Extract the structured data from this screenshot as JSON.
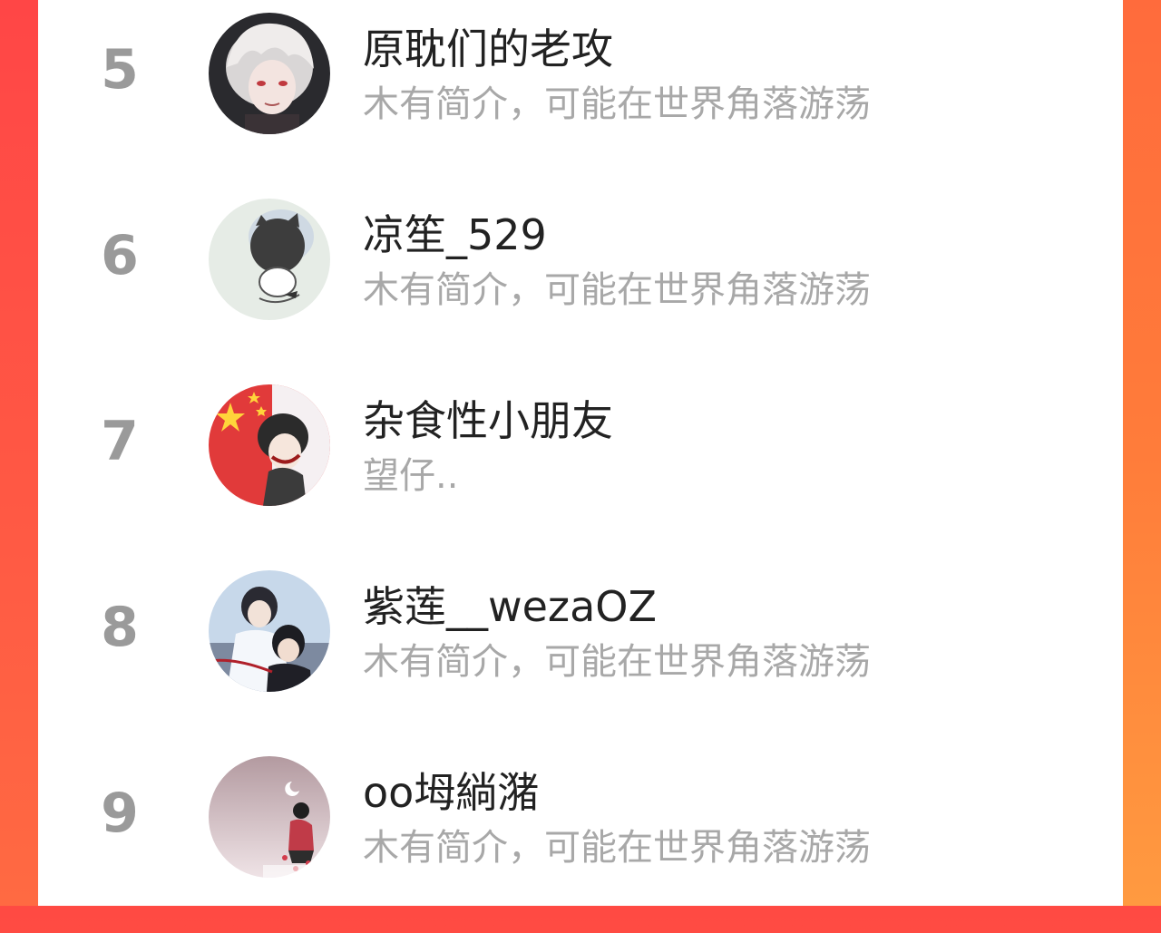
{
  "ranking": {
    "items": [
      {
        "rank": "5",
        "name": "原耽们的老攻",
        "bio": "木有简介，可能在世界角落游荡",
        "avatar_icon": "anime-white-hair-avatar"
      },
      {
        "rank": "6",
        "name": "凉笙_529",
        "bio": "木有简介，可能在世界角落游荡",
        "avatar_icon": "cartoon-pet-avatar"
      },
      {
        "rank": "7",
        "name": "杂食性小朋友",
        "bio": "望仔..",
        "avatar_icon": "flag-anime-avatar"
      },
      {
        "rank": "8",
        "name": "紫莲__wezaOZ",
        "bio": "木有简介，可能在世界角落游荡",
        "avatar_icon": "anime-duo-avatar"
      },
      {
        "rank": "9",
        "name": "oo坶緔潴",
        "bio": "木有简介，可能在世界角落游荡",
        "avatar_icon": "anime-moon-avatar"
      }
    ]
  },
  "colors": {
    "background_gradient_top": "#ff4a43",
    "background_gradient_bottom": "#ff8a3d",
    "rank_text": "#9a9a9a",
    "name_text": "#222222",
    "bio_text": "#a8a8a8"
  }
}
